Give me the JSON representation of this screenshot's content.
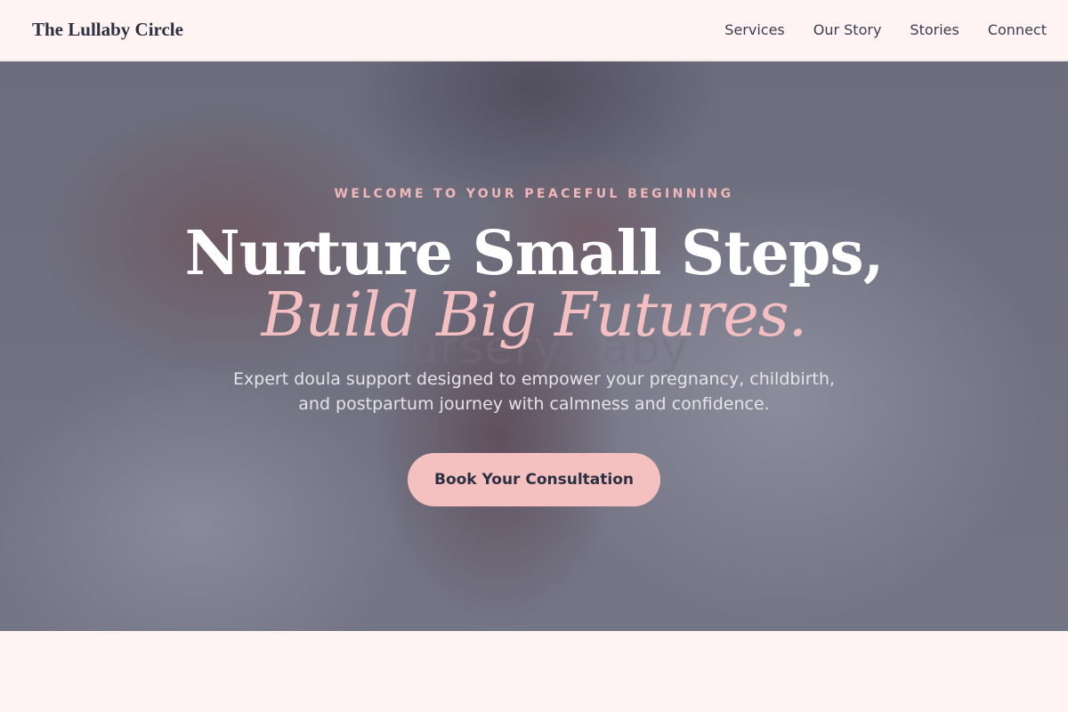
{
  "header": {
    "brand": "The Lullaby Circle",
    "nav": [
      {
        "label": "Services"
      },
      {
        "label": "Our Story"
      },
      {
        "label": "Stories"
      },
      {
        "label": "Connect"
      }
    ]
  },
  "hero": {
    "eyebrow": "WELCOME TO YOUR PEACEFUL BEGINNING",
    "headline_line1": "Nurture Small Steps,",
    "headline_line2": "Build Big Futures.",
    "watermark": "nursery.baby",
    "subtext": "Expert doula support designed to empower your pregnancy, childbirth, and postpartum journey with calmness and confidence.",
    "cta_label": "Book Your Consultation"
  },
  "colors": {
    "background": "#fff4f3",
    "accent_pink": "#f4c0c0",
    "text_dark": "#2d3040"
  }
}
